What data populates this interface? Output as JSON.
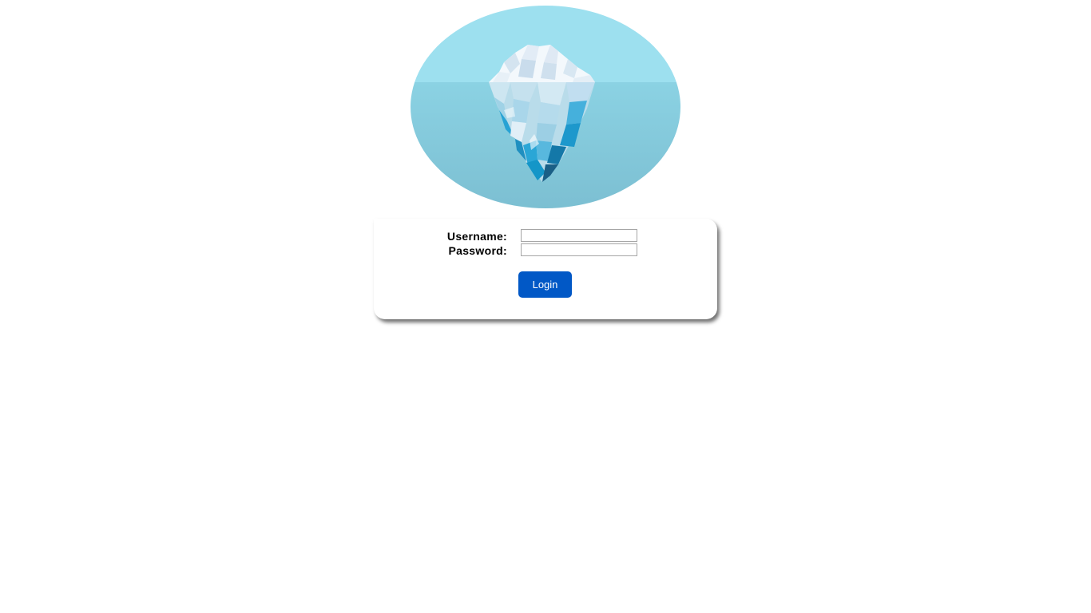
{
  "logo": {
    "name": "iceberg-logo",
    "colors": {
      "sky": "#9de0ef",
      "water": "#7fc4d6",
      "ice_light": "#e8f4fb",
      "ice_mid": "#b8dcec",
      "ice_deep": "#1a9ccc",
      "ice_dark": "#1a5f86"
    }
  },
  "form": {
    "username_label": "Username:",
    "password_label": "Password:",
    "username_value": "",
    "password_value": "",
    "login_label": "Login"
  },
  "colors": {
    "button": "#0158c6",
    "button_text": "#ffffff",
    "card_background": "#ffffff",
    "page_background": "#ffffff"
  }
}
